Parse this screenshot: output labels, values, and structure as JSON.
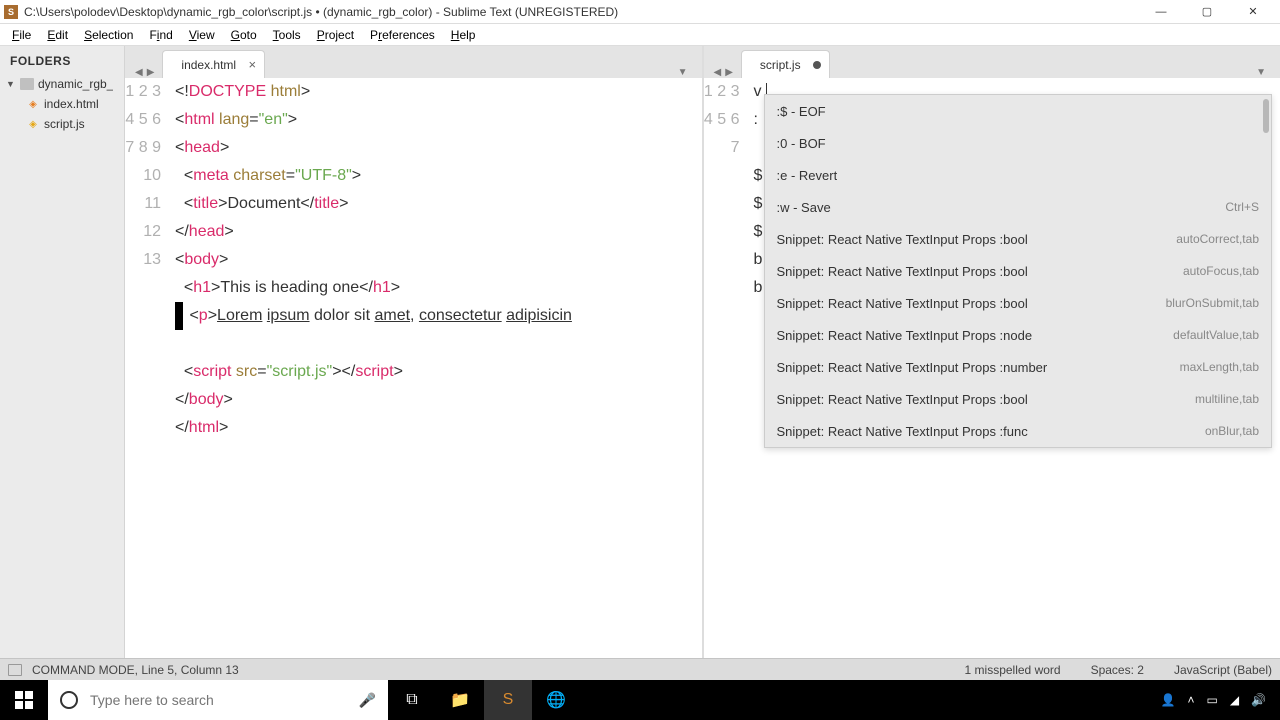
{
  "titlebar": {
    "title": "C:\\Users\\polodev\\Desktop\\dynamic_rgb_color\\script.js • (dynamic_rgb_color) - Sublime Text (UNREGISTERED)"
  },
  "menubar": [
    "File",
    "Edit",
    "Selection",
    "Find",
    "View",
    "Goto",
    "Tools",
    "Project",
    "Preferences",
    "Help"
  ],
  "sidebar": {
    "header": "FOLDERS",
    "root": "dynamic_rgb_",
    "files": [
      "index.html",
      "script.js"
    ]
  },
  "tabs": {
    "left": {
      "label": "index.html",
      "dirty": false
    },
    "right": {
      "label": "script.js",
      "dirty": true
    }
  },
  "left_code": {
    "lines": 13
  },
  "right_code": {
    "visible_chars": [
      "v",
      ":",
      "",
      "$",
      "$",
      "$",
      "b",
      "b"
    ],
    "input_prefix": ":"
  },
  "autocomplete": [
    {
      "label": ":$ - EOF",
      "hint": ""
    },
    {
      "label": ":0 - BOF",
      "hint": ""
    },
    {
      "label": ":e - Revert",
      "hint": ""
    },
    {
      "label": ":w - Save",
      "hint": "Ctrl+S"
    },
    {
      "label": "Snippet: React Native TextInput Props :bool",
      "hint": "autoCorrect,tab"
    },
    {
      "label": "Snippet: React Native TextInput Props :bool",
      "hint": "autoFocus,tab"
    },
    {
      "label": "Snippet: React Native TextInput Props :bool",
      "hint": "blurOnSubmit,tab"
    },
    {
      "label": "Snippet: React Native TextInput Props :node",
      "hint": "defaultValue,tab"
    },
    {
      "label": "Snippet: React Native TextInput Props :number",
      "hint": "maxLength,tab"
    },
    {
      "label": "Snippet: React Native TextInput Props :bool",
      "hint": "multiline,tab"
    },
    {
      "label": "Snippet: React Native TextInput Props :func",
      "hint": "onBlur,tab"
    }
  ],
  "statusbar": {
    "left": "COMMAND MODE, Line 5, Column 13",
    "spell": "1 misspelled word",
    "spaces": "Spaces: 2",
    "syntax": "JavaScript (Babel)"
  },
  "taskbar": {
    "search_placeholder": "Type here to search"
  }
}
